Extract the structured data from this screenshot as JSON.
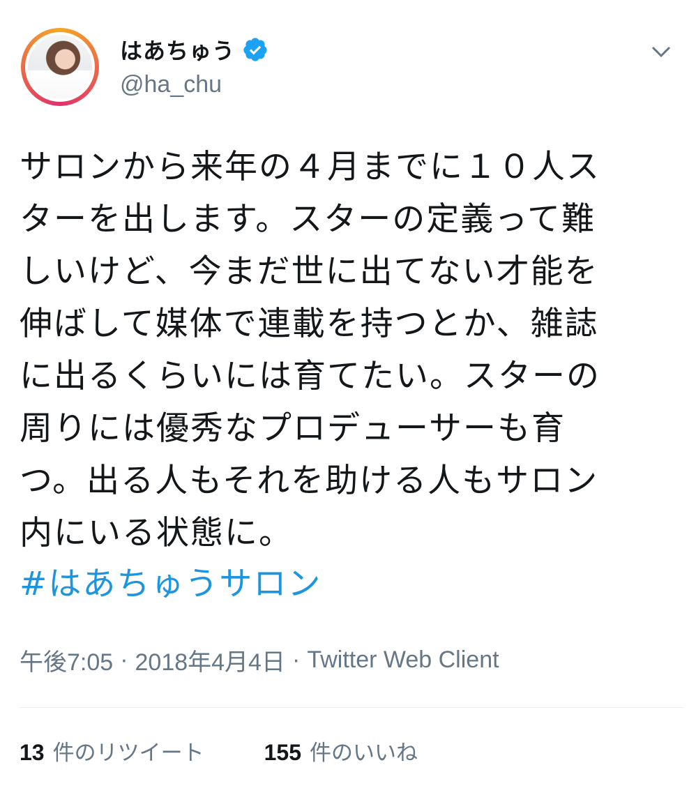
{
  "user": {
    "display_name": "はあちゅう",
    "handle": "@ha_chu",
    "verified": true,
    "avatar_icon": "profile-photo",
    "verified_icon": "verified-badge-icon"
  },
  "tweet": {
    "text": "サロンから来年の４月までに１０人ス\nターを出します。スターの定義って難\nしいけど、今まだ世に出てない才能を\n伸ばして媒体で連載を持つとか、雑誌\nに出るくらいには育てたい。スターの\n周りには優秀なプロデューサーも育\nつ。出る人もそれを助ける人もサロン\n内にいる状態に。",
    "hashtag": "#はあちゅうサロン"
  },
  "meta": {
    "time": "午後7:05",
    "separator": "·",
    "date": "2018年4月4日",
    "client": "Twitter Web Client"
  },
  "stats": {
    "retweets_count": "13",
    "retweets_label": "件のリツイート",
    "likes_count": "155",
    "likes_label": "件のいいね"
  },
  "colors": {
    "link": "#1b95e0",
    "verified": "#1da1f2",
    "secondary_text": "#657786",
    "primary_text": "#14171a"
  },
  "menu": {
    "chevron_icon": "chevron-down-icon"
  }
}
